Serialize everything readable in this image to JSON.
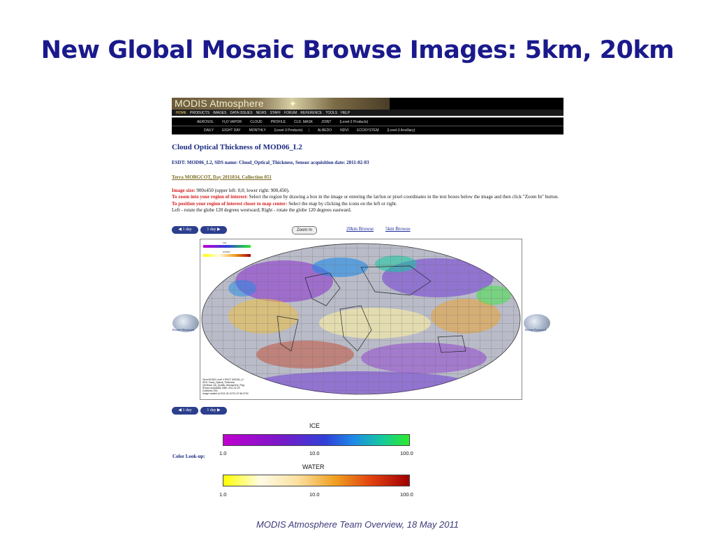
{
  "slide": {
    "title": "New Global Mosaic Browse Images: 5km, 20km",
    "footer": "MODIS Atmosphere Team Overview, 18 May 2011"
  },
  "site": {
    "logo": "MODIS Atmosphere",
    "nav_main": [
      "HOME",
      "PRODUCTS",
      "IMAGES",
      "DATA ISSUES",
      "NEWS",
      "STAFF",
      "FORUM",
      "REFERENCE",
      "TOOLS",
      "HELP"
    ],
    "nav_level2": [
      "AEROSOL",
      "H₂O VAPOR",
      "CLOUD",
      "PROFILE",
      "CLD. MASK",
      "JOINT",
      "(Level-2 Products)"
    ],
    "nav_level3": [
      "DAILY",
      "EIGHT DAY",
      "MONTHLY",
      "(Level-3 Products)",
      "|",
      "ALBEDO",
      "NDVI",
      "ECOSYSTEM",
      "(Level-3 Ancillary)"
    ]
  },
  "page": {
    "heading": "Cloud Optical Thickness of MOD06_L2",
    "esdt": "ESDT: MOD06_L2, SDS name: Cloud_Optical_Thickness, Sensor acquisition date: 2011-02-03",
    "mosaic_link": "Terra MOBGCOT, Day 2011034, Collection 051",
    "image_size_label": "Image size:",
    "image_size_text": " 900x450 (upper left: 0,0; lower right: 900,450).",
    "zoom_label": "To zoom into your region of interest:",
    "zoom_text": " Select the region by drawing a box in the image or entering the lat/lon or pixel coordinates in the text boxes below the image and then click \"Zoom In\" button.",
    "position_label": "To position your region of interest closer to map center:",
    "position_text": " Select the map by clicking the icons on the left or right.",
    "rotate_text": "Left - rotate the globe 120 degrees westward; Right - rotate the globe 120 degrees eastward."
  },
  "controls": {
    "prev_day": "◀ 1 day",
    "next_day": "1 day ▶",
    "zoom_in": "Zoom In",
    "browse_20km": "20km Browse",
    "browse_5km": "5km Browse",
    "rotate_west": "Rotate Westward",
    "rotate_east": "Rotate Eastward"
  },
  "map": {
    "mini_legend_ice": "ICE",
    "mini_legend_water": "WATER",
    "caption_lines": [
      "Terra MODIS Level 2 ESDT: MOD06_L2",
      "SDS: Cloud_Optical_Thickness",
      "QA Mask: QA_Quality_Atmosphere_Flag",
      "Sensor Acquisition Date: 2011-02-03",
      "Collection: 051",
      "Image created at 2011-02-10T21:07:48-0700"
    ]
  },
  "color_lookup": {
    "label": "Color Look-up:",
    "ice_title": "ICE",
    "water_title": "WATER",
    "ticks": [
      "1.0",
      "10.0",
      "100.0"
    ],
    "ice_colors": [
      "#c100d0",
      "#3040d8",
      "#2cea2c"
    ],
    "water_colors": [
      "#ffff00",
      "#f0a020",
      "#a00000"
    ]
  }
}
